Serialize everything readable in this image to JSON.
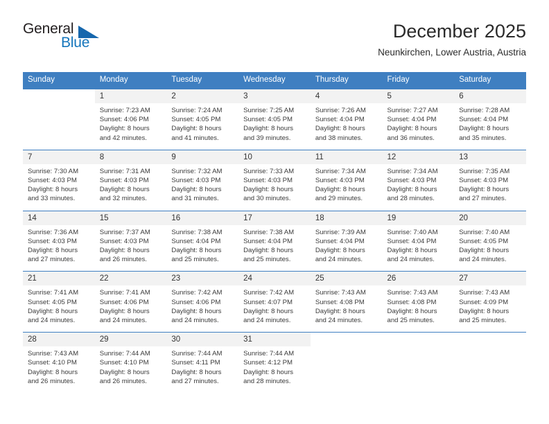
{
  "brand": {
    "name_part1": "General",
    "name_part2": "Blue",
    "triangle_color": "#1667ad",
    "text_color_part1": "#231f20",
    "text_color_part2": "#1676bc"
  },
  "header": {
    "title": "December 2025",
    "subtitle": "Neunkirchen, Lower Austria, Austria"
  },
  "theme": {
    "header_row_bg": "#3f7fc1",
    "header_row_text": "#ffffff",
    "daynum_bg": "#f2f2f2",
    "cell_text": "#3a3a3a",
    "week_divider": "#3f7fc1"
  },
  "weekday_headers": [
    "Sunday",
    "Monday",
    "Tuesday",
    "Wednesday",
    "Thursday",
    "Friday",
    "Saturday"
  ],
  "weeks": [
    {
      "days": [
        {
          "number": "",
          "lines": []
        },
        {
          "number": "1",
          "lines": [
            "Sunrise: 7:23 AM",
            "Sunset: 4:06 PM",
            "Daylight: 8 hours",
            "and 42 minutes."
          ]
        },
        {
          "number": "2",
          "lines": [
            "Sunrise: 7:24 AM",
            "Sunset: 4:05 PM",
            "Daylight: 8 hours",
            "and 41 minutes."
          ]
        },
        {
          "number": "3",
          "lines": [
            "Sunrise: 7:25 AM",
            "Sunset: 4:05 PM",
            "Daylight: 8 hours",
            "and 39 minutes."
          ]
        },
        {
          "number": "4",
          "lines": [
            "Sunrise: 7:26 AM",
            "Sunset: 4:04 PM",
            "Daylight: 8 hours",
            "and 38 minutes."
          ]
        },
        {
          "number": "5",
          "lines": [
            "Sunrise: 7:27 AM",
            "Sunset: 4:04 PM",
            "Daylight: 8 hours",
            "and 36 minutes."
          ]
        },
        {
          "number": "6",
          "lines": [
            "Sunrise: 7:28 AM",
            "Sunset: 4:04 PM",
            "Daylight: 8 hours",
            "and 35 minutes."
          ]
        }
      ]
    },
    {
      "days": [
        {
          "number": "7",
          "lines": [
            "Sunrise: 7:30 AM",
            "Sunset: 4:03 PM",
            "Daylight: 8 hours",
            "and 33 minutes."
          ]
        },
        {
          "number": "8",
          "lines": [
            "Sunrise: 7:31 AM",
            "Sunset: 4:03 PM",
            "Daylight: 8 hours",
            "and 32 minutes."
          ]
        },
        {
          "number": "9",
          "lines": [
            "Sunrise: 7:32 AM",
            "Sunset: 4:03 PM",
            "Daylight: 8 hours",
            "and 31 minutes."
          ]
        },
        {
          "number": "10",
          "lines": [
            "Sunrise: 7:33 AM",
            "Sunset: 4:03 PM",
            "Daylight: 8 hours",
            "and 30 minutes."
          ]
        },
        {
          "number": "11",
          "lines": [
            "Sunrise: 7:34 AM",
            "Sunset: 4:03 PM",
            "Daylight: 8 hours",
            "and 29 minutes."
          ]
        },
        {
          "number": "12",
          "lines": [
            "Sunrise: 7:34 AM",
            "Sunset: 4:03 PM",
            "Daylight: 8 hours",
            "and 28 minutes."
          ]
        },
        {
          "number": "13",
          "lines": [
            "Sunrise: 7:35 AM",
            "Sunset: 4:03 PM",
            "Daylight: 8 hours",
            "and 27 minutes."
          ]
        }
      ]
    },
    {
      "days": [
        {
          "number": "14",
          "lines": [
            "Sunrise: 7:36 AM",
            "Sunset: 4:03 PM",
            "Daylight: 8 hours",
            "and 27 minutes."
          ]
        },
        {
          "number": "15",
          "lines": [
            "Sunrise: 7:37 AM",
            "Sunset: 4:03 PM",
            "Daylight: 8 hours",
            "and 26 minutes."
          ]
        },
        {
          "number": "16",
          "lines": [
            "Sunrise: 7:38 AM",
            "Sunset: 4:04 PM",
            "Daylight: 8 hours",
            "and 25 minutes."
          ]
        },
        {
          "number": "17",
          "lines": [
            "Sunrise: 7:38 AM",
            "Sunset: 4:04 PM",
            "Daylight: 8 hours",
            "and 25 minutes."
          ]
        },
        {
          "number": "18",
          "lines": [
            "Sunrise: 7:39 AM",
            "Sunset: 4:04 PM",
            "Daylight: 8 hours",
            "and 24 minutes."
          ]
        },
        {
          "number": "19",
          "lines": [
            "Sunrise: 7:40 AM",
            "Sunset: 4:04 PM",
            "Daylight: 8 hours",
            "and 24 minutes."
          ]
        },
        {
          "number": "20",
          "lines": [
            "Sunrise: 7:40 AM",
            "Sunset: 4:05 PM",
            "Daylight: 8 hours",
            "and 24 minutes."
          ]
        }
      ]
    },
    {
      "days": [
        {
          "number": "21",
          "lines": [
            "Sunrise: 7:41 AM",
            "Sunset: 4:05 PM",
            "Daylight: 8 hours",
            "and 24 minutes."
          ]
        },
        {
          "number": "22",
          "lines": [
            "Sunrise: 7:41 AM",
            "Sunset: 4:06 PM",
            "Daylight: 8 hours",
            "and 24 minutes."
          ]
        },
        {
          "number": "23",
          "lines": [
            "Sunrise: 7:42 AM",
            "Sunset: 4:06 PM",
            "Daylight: 8 hours",
            "and 24 minutes."
          ]
        },
        {
          "number": "24",
          "lines": [
            "Sunrise: 7:42 AM",
            "Sunset: 4:07 PM",
            "Daylight: 8 hours",
            "and 24 minutes."
          ]
        },
        {
          "number": "25",
          "lines": [
            "Sunrise: 7:43 AM",
            "Sunset: 4:08 PM",
            "Daylight: 8 hours",
            "and 24 minutes."
          ]
        },
        {
          "number": "26",
          "lines": [
            "Sunrise: 7:43 AM",
            "Sunset: 4:08 PM",
            "Daylight: 8 hours",
            "and 25 minutes."
          ]
        },
        {
          "number": "27",
          "lines": [
            "Sunrise: 7:43 AM",
            "Sunset: 4:09 PM",
            "Daylight: 8 hours",
            "and 25 minutes."
          ]
        }
      ]
    },
    {
      "days": [
        {
          "number": "28",
          "lines": [
            "Sunrise: 7:43 AM",
            "Sunset: 4:10 PM",
            "Daylight: 8 hours",
            "and 26 minutes."
          ]
        },
        {
          "number": "29",
          "lines": [
            "Sunrise: 7:44 AM",
            "Sunset: 4:10 PM",
            "Daylight: 8 hours",
            "and 26 minutes."
          ]
        },
        {
          "number": "30",
          "lines": [
            "Sunrise: 7:44 AM",
            "Sunset: 4:11 PM",
            "Daylight: 8 hours",
            "and 27 minutes."
          ]
        },
        {
          "number": "31",
          "lines": [
            "Sunrise: 7:44 AM",
            "Sunset: 4:12 PM",
            "Daylight: 8 hours",
            "and 28 minutes."
          ]
        },
        {
          "number": "",
          "lines": []
        },
        {
          "number": "",
          "lines": []
        },
        {
          "number": "",
          "lines": []
        }
      ]
    }
  ]
}
